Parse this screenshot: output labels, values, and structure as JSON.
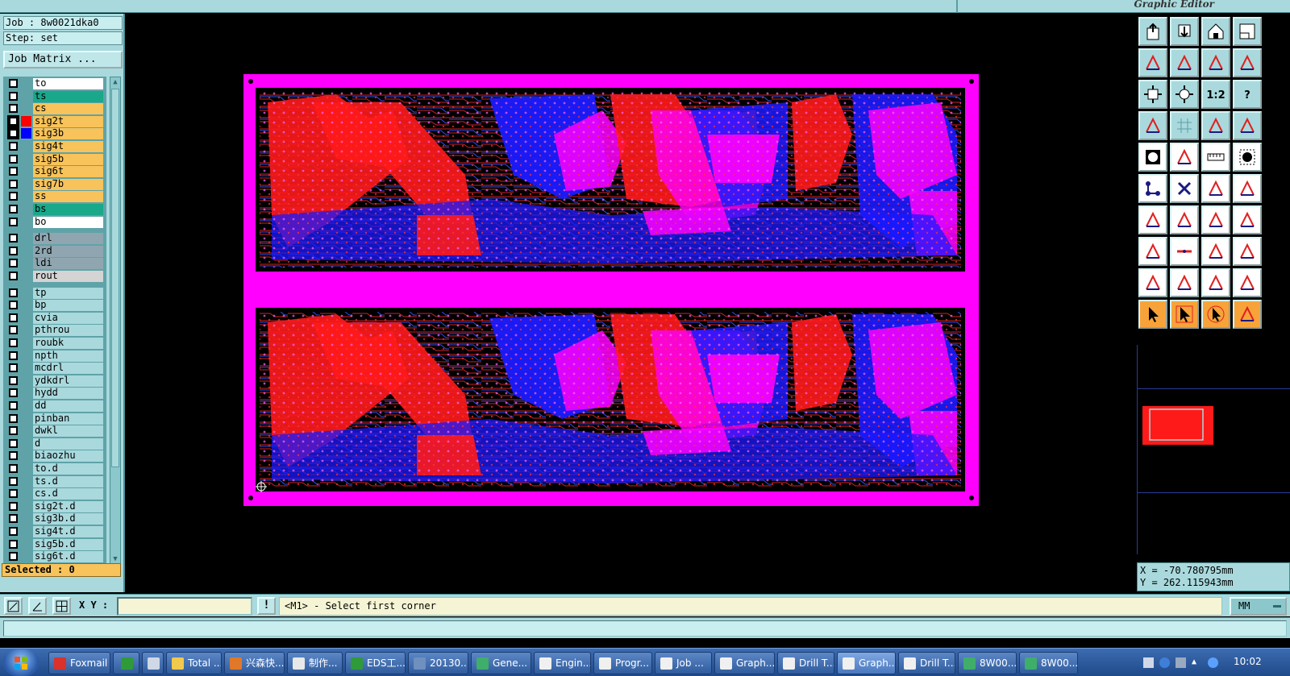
{
  "window": {
    "app_title": "Graphic Editor"
  },
  "left_panel": {
    "job_label": "Job : 8w0021dka0",
    "step_label": "Step: set",
    "job_matrix_button": "Job Matrix ...",
    "selected_label": "Selected : 0",
    "layers": [
      {
        "name": "to",
        "bg": "#ffffff",
        "swatch": null
      },
      {
        "name": "ts",
        "bg": "#19a88a",
        "swatch": null
      },
      {
        "name": "cs",
        "bg": "#f7c35a",
        "swatch": null
      },
      {
        "name": "sig2t",
        "bg": "#f7c35a",
        "swatch": "#ff0000",
        "active": true,
        "mark": "▪▪"
      },
      {
        "name": "sig3b",
        "bg": "#f7c35a",
        "swatch": "#0000ff",
        "active": true
      },
      {
        "name": "sig4t",
        "bg": "#f7c35a",
        "swatch": null
      },
      {
        "name": "sig5b",
        "bg": "#f7c35a",
        "swatch": null
      },
      {
        "name": "sig6t",
        "bg": "#f7c35a",
        "swatch": null
      },
      {
        "name": "sig7b",
        "bg": "#f7c35a",
        "swatch": null
      },
      {
        "name": "ss",
        "bg": "#f7c35a",
        "swatch": null
      },
      {
        "name": "bs",
        "bg": "#19a88a",
        "swatch": null
      },
      {
        "name": "bo",
        "bg": "#ffffff",
        "swatch": null
      },
      {
        "name": "drl",
        "bg": "#8fa6b0",
        "swatch": null
      },
      {
        "name": "2rd",
        "bg": "#8fa6b0",
        "swatch": null
      },
      {
        "name": "ldi",
        "bg": "#8fa6b0",
        "swatch": null
      },
      {
        "name": "rout",
        "bg": "#d4d4d4",
        "swatch": null
      },
      {
        "name": "tp",
        "bg": "#a9d9dd",
        "swatch": null
      },
      {
        "name": "bp",
        "bg": "#a9d9dd",
        "swatch": null
      },
      {
        "name": "cvia",
        "bg": "#a9d9dd",
        "swatch": null
      },
      {
        "name": "pthrou",
        "bg": "#a9d9dd",
        "swatch": null
      },
      {
        "name": "roubk",
        "bg": "#a9d9dd",
        "swatch": null
      },
      {
        "name": "npth",
        "bg": "#a9d9dd",
        "swatch": null
      },
      {
        "name": "mcdrl",
        "bg": "#a9d9dd",
        "swatch": null
      },
      {
        "name": "ydkdrl",
        "bg": "#a9d9dd",
        "swatch": null
      },
      {
        "name": "hydd",
        "bg": "#a9d9dd",
        "swatch": null
      },
      {
        "name": "dd",
        "bg": "#a9d9dd",
        "swatch": null
      },
      {
        "name": "pinban",
        "bg": "#a9d9dd",
        "swatch": null
      },
      {
        "name": "dwkl",
        "bg": "#a9d9dd",
        "swatch": null
      },
      {
        "name": "d",
        "bg": "#a9d9dd",
        "swatch": null
      },
      {
        "name": "biaozhu",
        "bg": "#a9d9dd",
        "swatch": null
      },
      {
        "name": "to.d",
        "bg": "#a9d9dd",
        "swatch": null,
        "mark": "✎"
      },
      {
        "name": "ts.d",
        "bg": "#a9d9dd",
        "swatch": null
      },
      {
        "name": "cs.d",
        "bg": "#a9d9dd",
        "swatch": null
      },
      {
        "name": "sig2t.d",
        "bg": "#a9d9dd",
        "swatch": null
      },
      {
        "name": "sig3b.d",
        "bg": "#a9d9dd",
        "swatch": null
      },
      {
        "name": "sig4t.d",
        "bg": "#a9d9dd",
        "swatch": null
      },
      {
        "name": "sig5b.d",
        "bg": "#a9d9dd",
        "swatch": null
      },
      {
        "name": "sig6t.d",
        "bg": "#a9d9dd",
        "swatch": null
      }
    ]
  },
  "toolbar": {
    "tools": [
      {
        "name": "open-job-icon",
        "style": "cyan"
      },
      {
        "name": "save-icon",
        "style": "cyan"
      },
      {
        "name": "home-icon",
        "style": "cyan"
      },
      {
        "name": "window-icon",
        "style": "cyan"
      },
      {
        "name": "zoom-left-icon",
        "style": "cyan"
      },
      {
        "name": "zoom-right-icon",
        "style": "cyan"
      },
      {
        "name": "undo-zoom-icon",
        "style": "cyan"
      },
      {
        "name": "redraw-icon",
        "style": "cyan"
      },
      {
        "name": "fit-screen-icon",
        "style": "cyan"
      },
      {
        "name": "center-icon",
        "style": "cyan"
      },
      {
        "name": "zoom-1to2-icon",
        "style": "cyan",
        "label": "1:2"
      },
      {
        "name": "help-icon",
        "style": "cyan",
        "label": "?"
      },
      {
        "name": "settings-icon",
        "style": "cyan"
      },
      {
        "name": "grid-icon",
        "style": "cyan"
      },
      {
        "name": "snap-icon",
        "style": "cyan"
      },
      {
        "name": "snap-alt-icon",
        "style": "cyan"
      },
      {
        "name": "select-shape-icon",
        "style": "white"
      },
      {
        "name": "add-shape-icon",
        "style": "white"
      },
      {
        "name": "measure-ruler-icon",
        "style": "white"
      },
      {
        "name": "pad-icon",
        "style": "white"
      },
      {
        "name": "connect-nodes-icon",
        "style": "white"
      },
      {
        "name": "delete-node-icon",
        "style": "white"
      },
      {
        "name": "add-node-icon",
        "style": "white"
      },
      {
        "name": "line-node-icon",
        "style": "white"
      },
      {
        "name": "draw-line-icon",
        "style": "white"
      },
      {
        "name": "draw-line-alt-icon",
        "style": "white"
      },
      {
        "name": "arc-icon",
        "style": "white"
      },
      {
        "name": "text-icon",
        "style": "white"
      },
      {
        "name": "pad-move-icon",
        "style": "white"
      },
      {
        "name": "horizontal-line-icon",
        "style": "white"
      },
      {
        "name": "dimension-icon",
        "style": "white"
      },
      {
        "name": "copy-pads-icon",
        "style": "white"
      },
      {
        "name": "angle-icon",
        "style": "white"
      },
      {
        "name": "angle-up-icon",
        "style": "white"
      },
      {
        "name": "angle-box-icon",
        "style": "white"
      },
      {
        "name": "angle-curve-icon",
        "style": "white"
      },
      {
        "name": "pointer-icon",
        "style": "orange"
      },
      {
        "name": "pointer-box-icon",
        "style": "orange"
      },
      {
        "name": "pointer-circle-icon",
        "style": "orange"
      },
      {
        "name": "pointer-route-icon",
        "style": "orange"
      }
    ]
  },
  "coordinates": {
    "x_label": "X = -70.780795mm",
    "y_label": "Y = 262.115943mm"
  },
  "command": {
    "xy_label": "X Y :",
    "xy_value": "",
    "warn_label": "!",
    "prompt_text": "<M1> - Select first corner",
    "units": "MM"
  },
  "taskbar": {
    "tasks": [
      {
        "label": "Foxmail",
        "color": "#d9312b"
      },
      {
        "label": "",
        "color": "#2f9a3a"
      },
      {
        "label": "",
        "color": "#cfd8e6"
      },
      {
        "label": "Total ...",
        "color": "#f2c94c"
      },
      {
        "label": "兴森快...",
        "color": "#e0782a"
      },
      {
        "label": "制作...",
        "color": "#e8e8e8"
      },
      {
        "label": "EDS工...",
        "color": "#2f9a3a"
      },
      {
        "label": "20130...",
        "color": "#6f8fbf"
      },
      {
        "label": "Gene...",
        "color": "#3fae6a"
      },
      {
        "label": "Engin...",
        "color": "#f0f0f0"
      },
      {
        "label": "Progr...",
        "color": "#f0f0f0"
      },
      {
        "label": "Job ...",
        "color": "#f0f0f0"
      },
      {
        "label": "Graph...",
        "color": "#f0f0f0"
      },
      {
        "label": "Drill T...",
        "color": "#f0f0f0"
      },
      {
        "label": "Graph...",
        "color": "#f0f0f0",
        "active": true
      },
      {
        "label": "Drill T...",
        "color": "#f0f0f0"
      },
      {
        "label": "8W00...",
        "color": "#3fae6a"
      },
      {
        "label": "8W00...",
        "color": "#3fae6a"
      }
    ],
    "clock": "10:02"
  },
  "colors": {
    "panel": "#a9d9dd",
    "layer_top": "#ff0000",
    "layer_bottom": "#0000ff",
    "overlap": "#ff00ff",
    "board_frame": "#ff00ff"
  }
}
